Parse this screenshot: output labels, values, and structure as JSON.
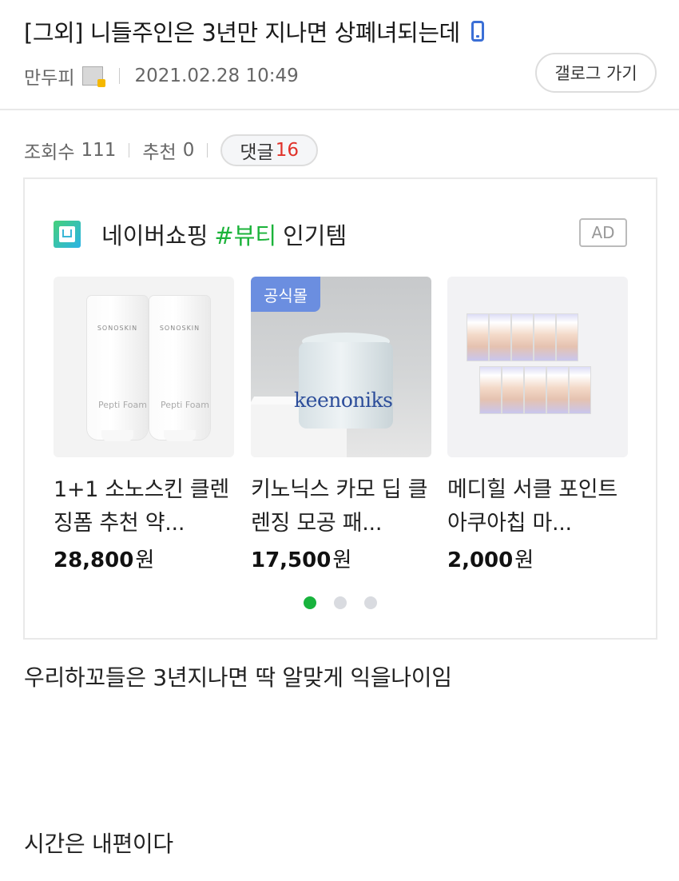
{
  "post": {
    "title": "[그외] 니들주인은 3년만 지나면 상폐녀되는데",
    "author": "만두피",
    "datetime": "2021.02.28 10:49",
    "gallog_button": "갤로그 가기",
    "views_label": "조회수",
    "views": "111",
    "recommend_label": "추천",
    "recommend": "0",
    "comments_label": "댓글",
    "comments": "16"
  },
  "ad": {
    "brand": "네이버쇼핑",
    "hashtag": "#뷰티",
    "suffix": "인기템",
    "badge": "AD",
    "products": [
      {
        "name": "1+1 소노스킨 클렌징폼 추천 약...",
        "price": "28,800",
        "currency": "원",
        "thumb_brand": "SONOSKIN",
        "thumb_product": "Pepti Foam"
      },
      {
        "name": "키노닉스 카모 딥 클렌징 모공 패...",
        "price": "17,500",
        "currency": "원",
        "official_tag": "공식몰",
        "thumb_brand": "keenoniks"
      },
      {
        "name": "메디힐 서클 포인트 아쿠아칩 마...",
        "price": "2,000",
        "currency": "원"
      }
    ],
    "pager": {
      "count": 3,
      "active": 0
    }
  },
  "content": {
    "line1": "우리하꼬들은 3년지나면 딱 알맞게 익을나이임",
    "line2": "시간은 내편이다"
  }
}
